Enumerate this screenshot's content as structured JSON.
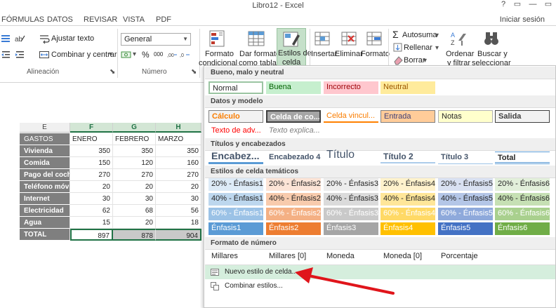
{
  "window": {
    "title": "Libro12 - Excel",
    "tabs": [
      "FÓRMULAS",
      "DATOS",
      "REVISAR",
      "VISTA",
      "PDF"
    ],
    "signin": "Iniciar sesión",
    "controls": [
      "?",
      "▭",
      "—",
      "▭"
    ]
  },
  "ribbon": {
    "wrap_text": "Ajustar texto",
    "merge_center": "Combinar y centrar",
    "alineacion_group": "Alineación",
    "number_format_value": "General",
    "percent": "%",
    "thousands": "000",
    "numero_group": "Número",
    "formato_condicional": [
      "Formato",
      "condicional"
    ],
    "dar_formato_tabla": [
      "Dar formato",
      "como tabla"
    ],
    "estilos_celda": [
      "Estilos de",
      "celda"
    ],
    "insertar": "Insertar",
    "eliminar": "Eliminar",
    "formato": "Formato",
    "autosuma": "Autosuma",
    "rellenar": "Rellenar",
    "borrar": "Borrar",
    "ordenar_filtrar": [
      "Ordenar",
      "y filtrar"
    ],
    "buscar_seleccionar": [
      "Buscar y",
      "seleccionar"
    ]
  },
  "grid": {
    "columns": [
      "E",
      "F",
      "G",
      "H"
    ],
    "header_row": [
      "GASTOS",
      "ENERO",
      "FEBRERO",
      "MARZO"
    ],
    "rows": [
      {
        "label": "Vivienda",
        "values": [
          "350",
          "350",
          "350"
        ]
      },
      {
        "label": "Comida",
        "values": [
          "150",
          "120",
          "160"
        ]
      },
      {
        "label": "Pago del coche",
        "values": [
          "270",
          "270",
          "270"
        ]
      },
      {
        "label": "Teléfono móvil",
        "values": [
          "20",
          "20",
          "20"
        ]
      },
      {
        "label": "Internet",
        "values": [
          "30",
          "30",
          "30"
        ]
      },
      {
        "label": "Electricidad",
        "values": [
          "62",
          "68",
          "56"
        ]
      },
      {
        "label": "Agua",
        "values": [
          "15",
          "20",
          "18"
        ]
      },
      {
        "label": "TOTAL",
        "values": [
          "897",
          "878",
          "904"
        ]
      }
    ]
  },
  "gallery": {
    "sections": {
      "bueno": "Bueno, malo y neutral",
      "datos": "Datos y modelo",
      "titulos": "Títulos y encabezados",
      "tematicos": "Estilos de celda temáticos",
      "numero": "Formato de número"
    },
    "bueno_row": [
      "Normal",
      "Buena",
      "Incorrecto",
      "Neutral"
    ],
    "datos_row1": [
      "Cálculo",
      "Celda de co...",
      "Celda vincul...",
      "Entrada",
      "Notas",
      "Salida"
    ],
    "datos_row2": [
      "Texto de adv...",
      "Texto explica..."
    ],
    "titulos_row": [
      "Encabez...",
      "Encabezado 4",
      "Título",
      "Título 2",
      "Título 3",
      "Total"
    ],
    "tematicos_20": [
      "20% - Énfasis1",
      "20% - Énfasis2",
      "20% - Énfasis3",
      "20% - Énfasis4",
      "20% - Énfasis5",
      "20% - Énfasis6"
    ],
    "tematicos_40": [
      "40% - Énfasis1",
      "40% - Énfasis2",
      "40% - Énfasis3",
      "40% - Énfasis4",
      "40% - Énfasis5",
      "40% - Énfasis6"
    ],
    "tematicos_60": [
      "60% - Énfasis1",
      "60% - Énfasis2",
      "60% - Énfasis3",
      "60% - Énfasis4",
      "60% - Énfasis5",
      "60% - Énfasis6"
    ],
    "tematicos_full": [
      "Énfasis1",
      "Énfasis2",
      "Énfasis3",
      "Énfasis4",
      "Énfasis5",
      "Énfasis6"
    ],
    "numero_row": [
      "Millares",
      "Millares [0]",
      "Moneda",
      "Moneda [0]",
      "Porcentaje"
    ],
    "nuevo_estilo": "Nuevo estilo de celda...",
    "combinar_estilos": "Combinar estilos..."
  },
  "colors": {
    "excel_green": "#217346",
    "arrow_red": "#e0151b",
    "enfasis": [
      "#5b9bd5",
      "#ed7d31",
      "#a5a5a5",
      "#ffc000",
      "#4472c4",
      "#70ad47"
    ]
  }
}
